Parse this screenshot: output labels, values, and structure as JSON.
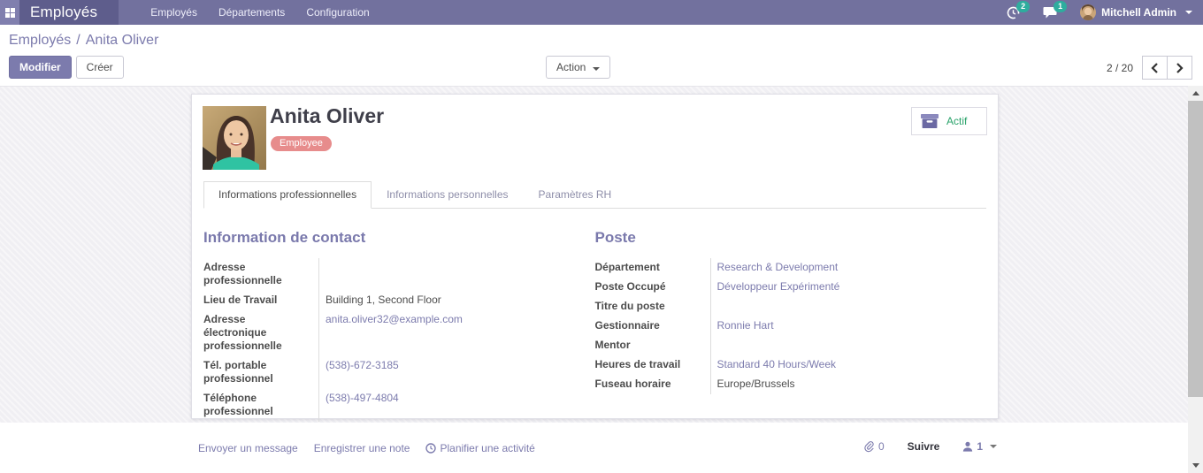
{
  "colors": {
    "navbar_bg": "#72719e",
    "brand_bg": "#5e5d8c",
    "accent_purple": "#7c7bad",
    "badge_teal": "#2ead9e",
    "tag_salmon": "#e78c8c",
    "active_green": "#28a269"
  },
  "navbar": {
    "brand": "Employés",
    "menus": [
      "Employés",
      "Départements",
      "Configuration"
    ],
    "activity_badge": "2",
    "messages_badge": "1",
    "user_name": "Mitchell Admin"
  },
  "control_panel": {
    "breadcrumb_parent": "Employés",
    "breadcrumb_separator": "/",
    "breadcrumb_current": "Anita Oliver",
    "edit_label": "Modifier",
    "create_label": "Créer",
    "action_label": "Action",
    "pager_value": "2 / 20"
  },
  "sheet": {
    "employee_name": "Anita Oliver",
    "employee_tag": "Employee",
    "active_label": "Actif",
    "tabs": [
      {
        "label": "Informations professionnelles"
      },
      {
        "label": "Informations personnelles"
      },
      {
        "label": "Paramètres RH"
      }
    ],
    "contact": {
      "title": "Information de contact",
      "fields": [
        {
          "label": "Adresse professionnelle",
          "value": ""
        },
        {
          "label": "Lieu de Travail",
          "value": "Building 1, Second Floor"
        },
        {
          "label": "Adresse électronique professionnelle",
          "value": "anita.oliver32@example.com"
        },
        {
          "label": "Tél. portable professionnel",
          "value": "(538)-672-3185"
        },
        {
          "label": "Téléphone professionnel",
          "value": "(538)-497-4804"
        }
      ]
    },
    "position": {
      "title": "Poste",
      "fields": [
        {
          "label": "Département",
          "value": "Research & Development"
        },
        {
          "label": "Poste Occupé",
          "value": "Développeur Expérimenté"
        },
        {
          "label": "Titre du poste",
          "value": ""
        },
        {
          "label": "Gestionnaire",
          "value": "Ronnie Hart"
        },
        {
          "label": "Mentor",
          "value": ""
        },
        {
          "label": "Heures de travail",
          "value": "Standard 40 Hours/Week"
        },
        {
          "label": "Fuseau horaire",
          "value": "Europe/Brussels"
        }
      ]
    }
  },
  "chatter": {
    "send_message": "Envoyer un message",
    "log_note": "Enregistrer une note",
    "schedule_activity": "Planifier une activité",
    "attachment_count": "0",
    "follow_label": "Suivre",
    "follower_count": "1"
  }
}
